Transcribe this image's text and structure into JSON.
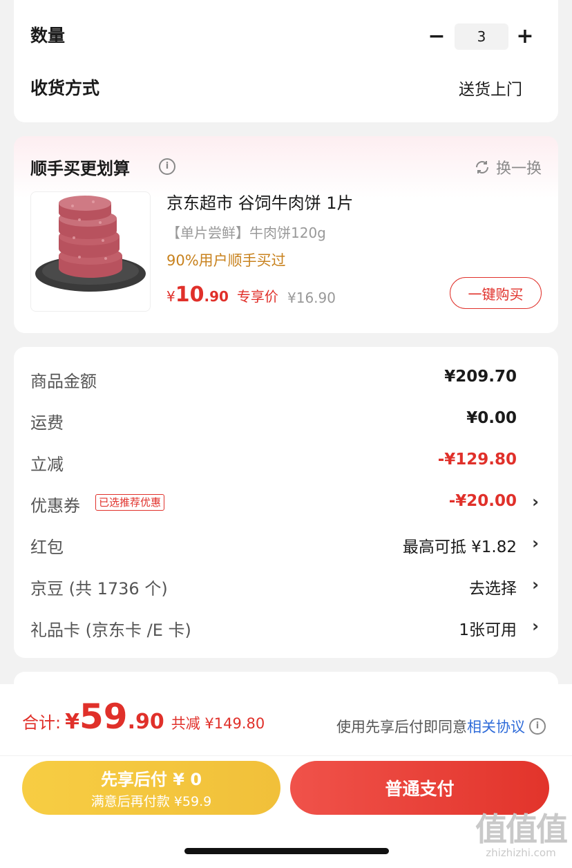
{
  "quantity_card": {
    "quantity_label": "数量",
    "minus": "−",
    "quantity": "3",
    "plus": "+",
    "delivery_label": "收货方式",
    "delivery_value": "送货上门"
  },
  "addon": {
    "title": "顺手买更划算",
    "info": "i",
    "refresh_label": "换一换",
    "product": {
      "title": "京东超市 谷饲牛肉饼 1片",
      "spec": "【单片尝鲜】牛肉饼120g",
      "bought": "90%用户顺手买过",
      "price_symbol": "¥",
      "price_int": "10",
      "price_dec": ".90",
      "price_tag": "专享价",
      "original_price": "¥16.90",
      "buy_button": "一键购买"
    }
  },
  "summary": {
    "rows": [
      {
        "label": "商品金额",
        "value": "¥209.70"
      },
      {
        "label": "运费",
        "value": "¥0.00"
      },
      {
        "label": "立减",
        "value": "-¥129.80"
      },
      {
        "label": "优惠券",
        "badge": "已选推荐优惠",
        "value": "-¥20.00",
        "chevron": "›"
      },
      {
        "label": "红包",
        "value": "最高可抵 ¥1.82",
        "chevron": "›"
      },
      {
        "label": "京豆 (共 1736 个)",
        "value": "去选择",
        "chevron": "›"
      },
      {
        "label": "礼品卡 (京东卡 /E 卡)",
        "value": "1张可用",
        "chevron": "›"
      }
    ]
  },
  "bottom": {
    "total_label": "合计:",
    "total_symbol": "¥",
    "total_int": "59",
    "total_dec": ".90",
    "saved": "共减 ¥149.80",
    "agree_text": "使用先享后付即同意",
    "agree_link": "相关协议",
    "agree_info": "i",
    "pay_later_line1": "先享后付 ¥ 0",
    "pay_later_line2": "满意后再付款 ¥59.9",
    "pay_normal": "普通支付"
  },
  "watermark": {
    "big": "值值值",
    "small": "zhizhizhi.com"
  },
  "colors": {
    "accent_red": "#e0302a",
    "gold": "#c8821e",
    "yellow_btn": "#f7cd43",
    "link_blue": "#2e6bd9"
  }
}
